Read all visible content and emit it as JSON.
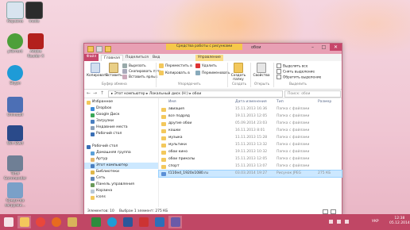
{
  "desktop_icons": [
    {
      "label": "Корзина",
      "icon": "recycle-bin-icon"
    },
    {
      "label": "Inode",
      "icon": "inode-icon"
    },
    {
      "label": "µTorrent",
      "icon": "utorrent-icon"
    },
    {
      "label": "Adobe\nReader X",
      "icon": "adobe-reader-icon"
    },
    {
      "label": "Skype",
      "icon": "skype-icon"
    },
    {
      "label": "Uninstall",
      "icon": "uninstall-icon"
    },
    {
      "label": "Win Dwd",
      "icon": "windvd-icon"
    },
    {
      "label": "Total\nCommander",
      "icon": "total-commander-icon"
    },
    {
      "label": "Средства\nзагрузки...",
      "icon": "download-tool-icon"
    },
    {
      "label": "Microsoft\nWindows 8",
      "icon": "windows-media-icon"
    }
  ],
  "window": {
    "title": "обои",
    "context_tab": "Средства работы с рисунками",
    "context_subtab": "Управление",
    "controls": {
      "minimize": "–",
      "maximize": "□",
      "close": "✕"
    }
  },
  "ribbon_tabs": [
    "Файл",
    "Главная",
    "Поделиться",
    "Вид"
  ],
  "ribbon": {
    "copy": "Копировать",
    "paste": "Вставить",
    "cut": "Вырезать",
    "copy_path": "Скопировать путь",
    "paste_shortcut": "Вставить ярлык",
    "move_to": "Переместить в",
    "copy_to": "Копировать в",
    "delete": "Удалить",
    "rename": "Переименовать",
    "new_folder": "Создать папку",
    "properties": "Свойства",
    "select_all": "Выделить все",
    "select_none": "Снять выделение",
    "invert_selection": "Обратить выделение",
    "group_clipboard": "Буфер обмена",
    "group_organize": "Упорядочить",
    "group_new": "Создать",
    "group_open": "Открыть",
    "group_select": "Выделить"
  },
  "address": {
    "path": "▸ Этот компьютер ▸ Локальный диск (H:) ▸ обои",
    "search_placeholder": "Поиск: обои",
    "nav_back": "←",
    "nav_forward": "→",
    "nav_up": "↑"
  },
  "nav_pane": [
    {
      "label": "Избранное",
      "icon": "star-icon",
      "indent": 0
    },
    {
      "label": "Dropbox",
      "icon": "dropbox-icon",
      "indent": 1
    },
    {
      "label": "Google Диск",
      "icon": "google-drive-icon",
      "indent": 1
    },
    {
      "label": "Загрузки",
      "icon": "downloads-icon",
      "indent": 1
    },
    {
      "label": "Недавние места",
      "icon": "recent-places-icon",
      "indent": 1
    },
    {
      "label": "Рабочий стол",
      "icon": "desktop-icon",
      "indent": 1
    },
    {
      "label": "",
      "icon": "",
      "indent": 0
    },
    {
      "label": "Рабочий стол",
      "icon": "desktop-icon",
      "indent": 0
    },
    {
      "label": "Домашняя группа",
      "icon": "homegroup-icon",
      "indent": 1
    },
    {
      "label": "Артур",
      "icon": "user-icon",
      "indent": 1
    },
    {
      "label": "Этот компьютер",
      "icon": "computer-icon",
      "indent": 1,
      "selected": true
    },
    {
      "label": "Библиотеки",
      "icon": "libraries-icon",
      "indent": 1
    },
    {
      "label": "Сеть",
      "icon": "network-icon",
      "indent": 1
    },
    {
      "label": "Панель управления",
      "icon": "control-panel-icon",
      "indent": 1
    },
    {
      "label": "Корзина",
      "icon": "recycle-bin-icon",
      "indent": 1
    },
    {
      "label": "icons",
      "icon": "folder-icon",
      "indent": 1
    }
  ],
  "columns": {
    "name": "Имя",
    "date": "Дата изменения",
    "type": "Тип",
    "size": "Размер"
  },
  "files": [
    {
      "name": "авиация",
      "date": "15.11.2013 16:36",
      "type": "Папка с файлами",
      "size": ""
    },
    {
      "name": "все подряд",
      "date": "19.11.2013 12:05",
      "type": "Папка с файлами",
      "size": ""
    },
    {
      "name": "другие обои",
      "date": "05.09.2014 23:03",
      "type": "Папка с файлами",
      "size": ""
    },
    {
      "name": "кошки",
      "date": "16.11.2013 8:01",
      "type": "Папка с файлами",
      "size": ""
    },
    {
      "name": "музыка",
      "date": "11.11.2013 15:28",
      "type": "Папка с файлами",
      "size": ""
    },
    {
      "name": "мультики",
      "date": "15.11.2013 13:32",
      "type": "Папка с файлами",
      "size": ""
    },
    {
      "name": "обои кино",
      "date": "19.11.2013 10:32",
      "type": "Папка с файлами",
      "size": ""
    },
    {
      "name": "обои приколы",
      "date": "15.11.2013 12:05",
      "type": "Папка с файлами",
      "size": ""
    },
    {
      "name": "спорт",
      "date": "15.11.2013 13:07",
      "type": "Папка с файлами",
      "size": ""
    },
    {
      "name": "t110ed_1920x1080.ru",
      "date": "03.03.2014 19:27",
      "type": "Рисунок JPEG",
      "size": "275 КБ",
      "selected": true
    }
  ],
  "status": {
    "count": "Элементов: 10",
    "selection": "Выбран 1 элемент: 275 КБ"
  },
  "taskbar": {
    "items": [
      "start-icon",
      "file-explorer-icon",
      "chrome-icon",
      "browser-icon",
      "spreadsheet-icon",
      "skype-icon",
      "word-icon",
      "media-icon",
      "photos-icon",
      "settings-icon"
    ],
    "tray_lang": "УКР",
    "time": "12:38",
    "date": "05.12.2014"
  },
  "colors": {
    "accent": "#c04765",
    "selection": "#cce8ff",
    "folder": "#f3c85c"
  }
}
